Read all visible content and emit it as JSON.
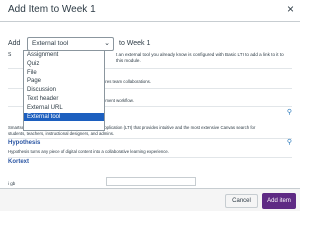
{
  "modal": {
    "title": "Add Item to Week 1",
    "close_symbol": "×"
  },
  "add_row": {
    "add_label": "Add",
    "selected_type": "External tool",
    "to_label": "to Week 1"
  },
  "instructions": {
    "line1": "t an external tool you already know is configured with Basic LTI to add a link to it to",
    "line2": "this module."
  },
  "left_stub": "S",
  "type_options": [
    "Assignment",
    "Quiz",
    "File",
    "Page",
    "Discussion",
    "Text header",
    "External URL",
    "External tool"
  ],
  "tools": [
    {
      "name": "",
      "desc": "ures team collaborations."
    },
    {
      "name": "",
      "desc": "ement workflow."
    },
    {
      "name": "",
      "desc": "Smartsearch for Canvas is an integrated Canvas application (LTI) that provides intuitive and the most extensive Canvas search for"
    },
    {
      "name": "",
      "desc": "students, teachers, instructional designers, and admins."
    },
    {
      "name": "Hypothesis",
      "desc": "Hypothesis turns any piece of digital content into a collaborative learning experience."
    },
    {
      "name": "Kortext",
      "desc": ""
    }
  ],
  "small_label": "i gb",
  "footer": {
    "cancel_label": "Cancel",
    "add_label": "Add item"
  },
  "colors": {
    "primary_button": "#5e2a84",
    "selected_option": "#1c5fbf",
    "link": "#2b56a3",
    "icon": "#2b7abc"
  },
  "icons": {
    "close": "close-icon",
    "chevron": "chevron-down-icon",
    "search": "search-icon"
  }
}
